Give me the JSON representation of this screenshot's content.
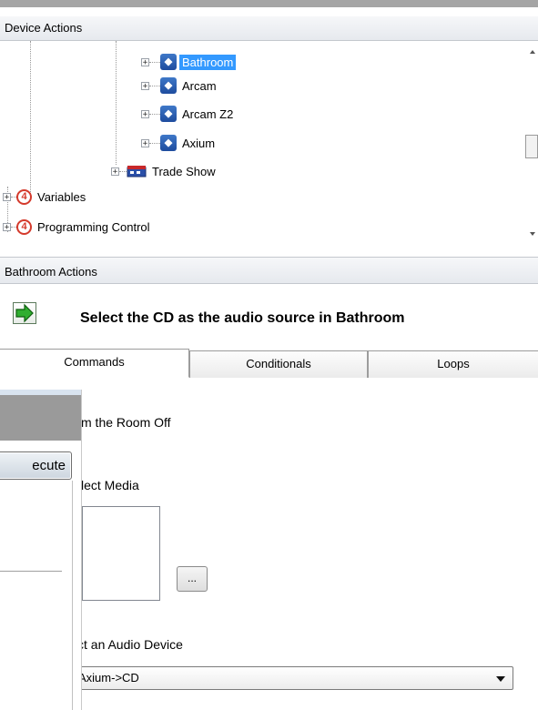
{
  "device_actions": {
    "header": "Device Actions",
    "tree": {
      "rooms": [
        {
          "label": "Bathroom",
          "selected": true,
          "icon": "room-icon"
        },
        {
          "label": "Arcam",
          "selected": false,
          "icon": "room-icon"
        },
        {
          "label": "Arcam Z2",
          "selected": false,
          "icon": "room-icon"
        },
        {
          "label": "Axium",
          "selected": false,
          "icon": "room-icon"
        }
      ],
      "trade_show": {
        "label": "Trade Show",
        "icon": "building-icon"
      },
      "variables": {
        "label": "Variables",
        "icon": "control4-logo-icon"
      },
      "programming_control": {
        "label": "Programming Control",
        "icon": "control4-logo-icon"
      },
      "expander_symbol": "+"
    }
  },
  "bathroom_actions": {
    "header": "Bathroom Actions",
    "action_text": "Select the CD as the audio source in Bathroom",
    "action_icon": "green-arrow-icon"
  },
  "tabs": [
    {
      "label": "Commands",
      "active": true
    },
    {
      "label": "Conditionals",
      "active": false
    },
    {
      "label": "Loops",
      "active": false
    }
  ],
  "commands": {
    "room_off_label": "m the Room Off",
    "select_media_label": "lect Media",
    "browse_label": "...",
    "audio_device_label": "ct an Audio Device",
    "audio_device_value": "Axium->CD"
  },
  "overlay": {
    "execute_label": "ecute"
  },
  "colors": {
    "selection": "#3399ff",
    "header_bg": "#e6e9ee",
    "control4_red": "#d43a2c",
    "arrow_green": "#2fae2f"
  }
}
